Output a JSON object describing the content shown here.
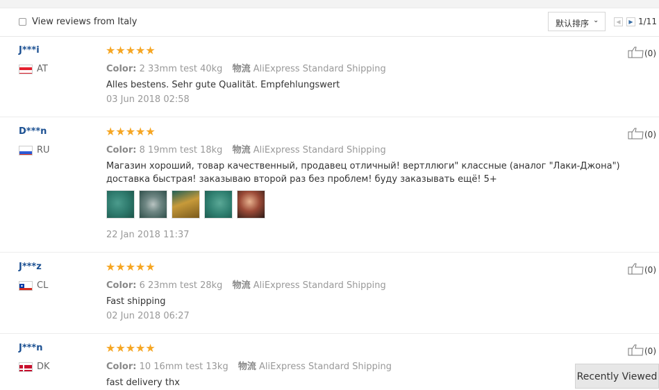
{
  "toolbar": {
    "filter_label": "View reviews from Italy",
    "sort_label": "默认排序",
    "page_indicator": "1/11"
  },
  "reviews": [
    {
      "user": "J***i",
      "country": "AT",
      "rating": 5,
      "stars": "★★★★★",
      "color_key": "Color:",
      "color_value": "2 33mm test 40kg",
      "shipping_key": "物流",
      "shipping_value": "AliExpress Standard Shipping",
      "text": "Alles bestens. Sehr gute Qualität. Empfehlungswert",
      "date": "03 Jun 2018 02:58",
      "useful": "(0)"
    },
    {
      "user": "D***n",
      "country": "RU",
      "rating": 5,
      "stars": "★★★★★",
      "color_key": "Color:",
      "color_value": "8 19mm test 18kg",
      "shipping_key": "物流",
      "shipping_value": "AliExpress Standard Shipping",
      "text": "Магазин хороший, товар качественный, продавец отличный! вертллюги\" классные (аналог \"Лаки-Джона\") доставка быстрая! заказываю второй раз без проблем! буду заказывать ещё! 5+",
      "date": "22 Jan 2018 11:37",
      "useful": "(0)",
      "photos": 5
    },
    {
      "user": "J***z",
      "country": "CL",
      "rating": 5,
      "stars": "★★★★★",
      "color_key": "Color:",
      "color_value": "6 23mm test 28kg",
      "shipping_key": "物流",
      "shipping_value": "AliExpress Standard Shipping",
      "text": "Fast shipping",
      "date": "02 Jun 2018 06:27",
      "useful": "(0)"
    },
    {
      "user": "J***n",
      "country": "DK",
      "rating": 5,
      "stars": "★★★★★",
      "color_key": "Color:",
      "color_value": "10 16mm test 13kg",
      "shipping_key": "物流",
      "shipping_value": "AliExpress Standard Shipping",
      "text": "fast delivery thx",
      "useful": "(0)"
    }
  ],
  "recently_viewed": "Recently Viewed",
  "colors": {
    "username": "#1a4f91",
    "star": "#f6a623",
    "meta_text": "#999999",
    "divider": "#ececec"
  },
  "icons": {
    "filter": "checkbox",
    "sort": "chevron-down-icon",
    "prev": "caret-left-icon",
    "next": "caret-right-icon",
    "useful": "thumbs-up-icon"
  }
}
